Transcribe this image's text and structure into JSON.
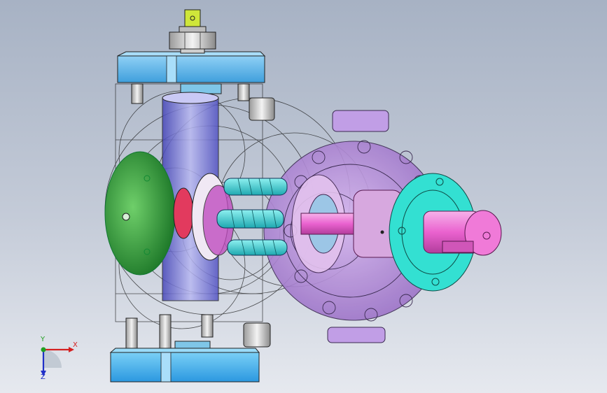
{
  "viewport": {
    "background_top": "#a7b2c4",
    "background_bottom": "#e6e9ef"
  },
  "model": {
    "parts": [
      {
        "name": "top-cap-plate",
        "color": "#5fb5ea"
      },
      {
        "name": "bottom-cap-plate",
        "color": "#3fb0ec"
      },
      {
        "name": "hex-nut",
        "color": "#d8d8d8"
      },
      {
        "name": "fitting-yellow",
        "color": "#cfe63a"
      },
      {
        "name": "green-end-cover",
        "color": "#2f9a3c"
      },
      {
        "name": "purple-housing-flange",
        "color": "#b28bd8"
      },
      {
        "name": "cyan-shaft-flange",
        "color": "#33e0d2"
      },
      {
        "name": "pink-drive-shaft",
        "color": "#ee78d6"
      },
      {
        "name": "cyan-rotor-screws",
        "color": "#2bc7c9"
      },
      {
        "name": "red-seal-ring",
        "color": "#e23a5e"
      },
      {
        "name": "blue-cylinder-body",
        "color": "#6a6ad6"
      }
    ]
  },
  "triad": {
    "x_label": "X",
    "y_label": "Y",
    "z_label": "Z",
    "x_color": "#d42020",
    "y_color": "#22a022",
    "z_color": "#2030c8"
  }
}
